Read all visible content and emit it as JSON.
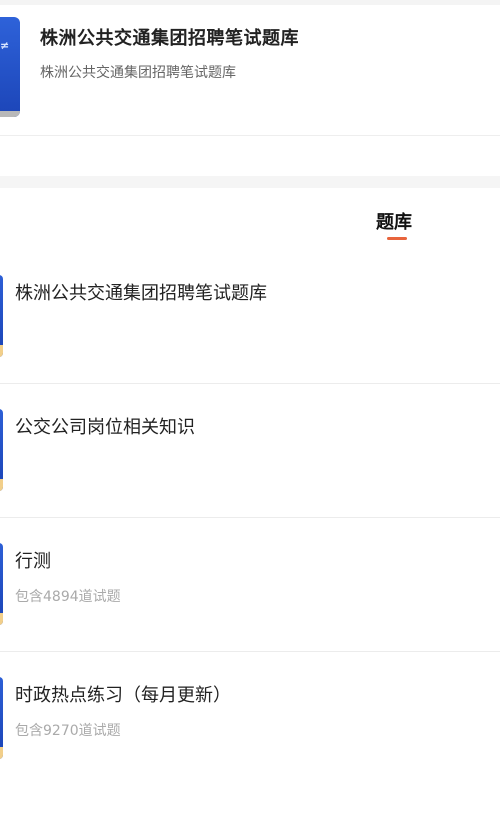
{
  "header": {
    "title": "株洲公共交通集团招聘笔试题库",
    "subtitle": "株洲公共交通集团招聘笔试题库",
    "cover_color": "#2458d0"
  },
  "tabs": [
    {
      "label": "题库",
      "active": true
    }
  ],
  "colors": {
    "accent": "#e8643c",
    "title_text": "#222222",
    "muted_text": "#aaaaaa"
  },
  "items": [
    {
      "title": "株洲公共交通集团招聘笔试题库",
      "count": ""
    },
    {
      "title": "公交公司岗位相关知识",
      "count": ""
    },
    {
      "title": "行测",
      "count": "包含4894道试题"
    },
    {
      "title": "时政热点练习（每月更新）",
      "count": "包含9270道试题"
    }
  ]
}
